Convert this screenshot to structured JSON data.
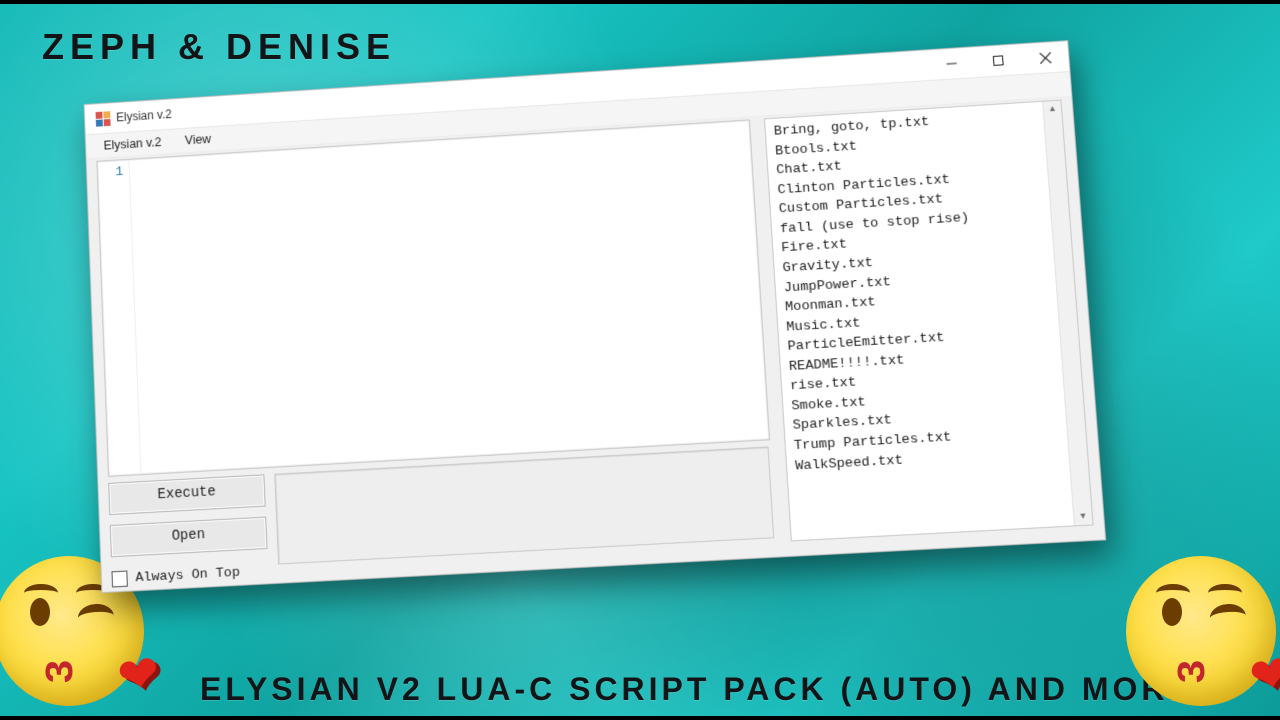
{
  "overlay": {
    "top_text": "ZEPH  &  DENISE",
    "bottom_text": "ELYSIAN V2 LUA-C SCRIPT PACK (AUTO) AND MORE!"
  },
  "window": {
    "title": "Elysian v.2",
    "menu": {
      "item1": "Elysian v.2",
      "item2": "View"
    },
    "editor": {
      "line_number": "1"
    },
    "buttons": {
      "execute": "Execute",
      "open": "Open"
    },
    "checkbox_label": "Always On Top",
    "files": [
      "Bring, goto, tp.txt",
      "Btools.txt",
      "Chat.txt",
      "Clinton Particles.txt",
      "Custom Particles.txt",
      "fall (use to stop rise)",
      "Fire.txt",
      "Gravity.txt",
      "JumpPower.txt",
      "Moonman.txt",
      "Music.txt",
      "ParticleEmitter.txt",
      "README!!!!.txt",
      "rise.txt",
      "Smoke.txt",
      "Sparkles.txt",
      "Trump Particles.txt",
      "WalkSpeed.txt"
    ]
  },
  "emoji": {
    "mouth": "3",
    "heart": "❤"
  }
}
